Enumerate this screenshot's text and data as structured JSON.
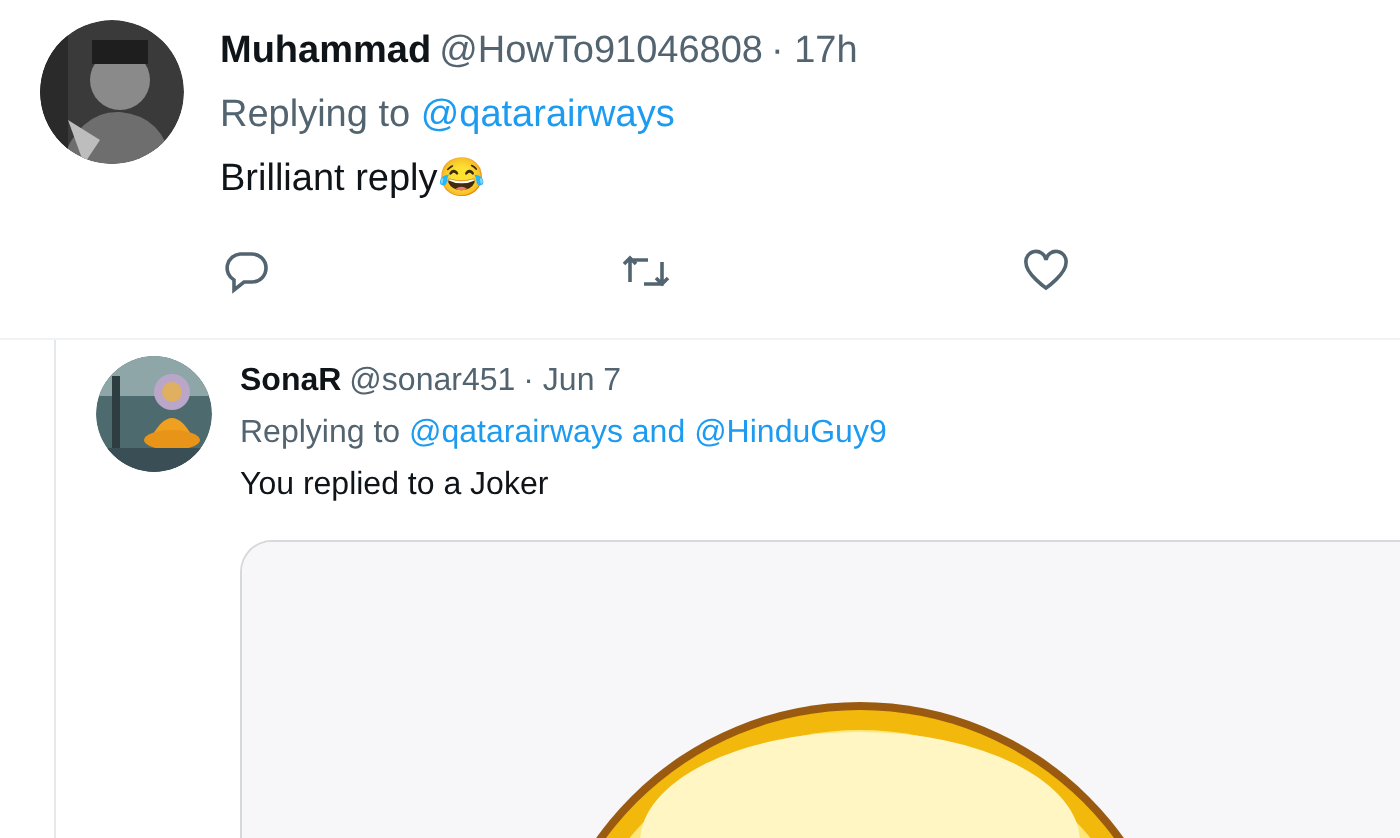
{
  "tweet": {
    "name": "Muhammad",
    "handle": "@HowTo91046808",
    "time": "· 17h",
    "replying_label": "Replying to",
    "replying_to": [
      "@qatarairways"
    ],
    "text": "Brilliant reply😂"
  },
  "quoted_reply": {
    "name": "SonaR",
    "handle": "@sonar451",
    "time": "· Jun 7",
    "replying_label": "Replying to",
    "replying_to": [
      "@qatarairways",
      "@HinduGuy9"
    ],
    "joiner": "and",
    "text": "You replied to a Joker"
  }
}
